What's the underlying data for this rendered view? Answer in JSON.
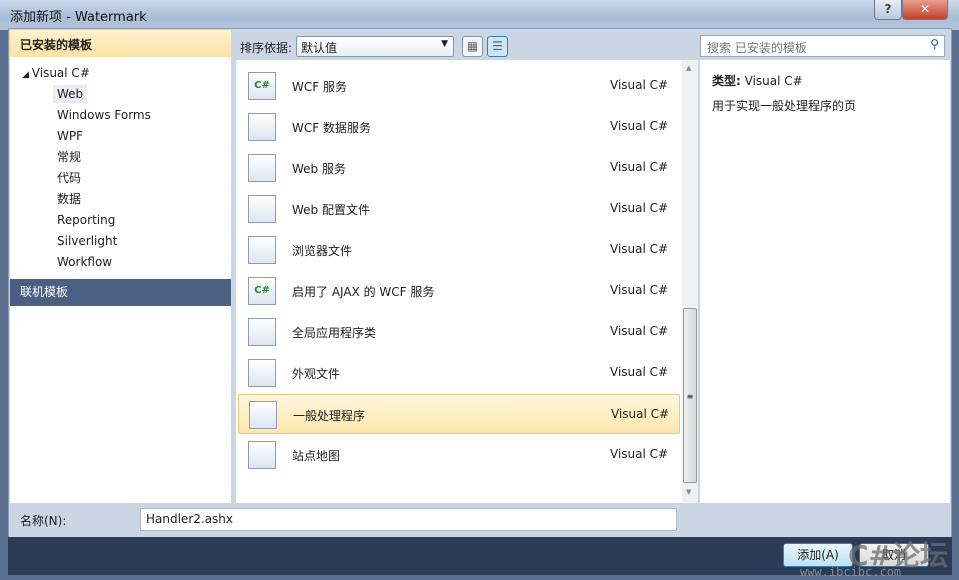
{
  "window": {
    "title": "添加新项 - Watermark",
    "help": "?",
    "close": "✕"
  },
  "left": {
    "header": "已安装的模板",
    "root": "Visual C#",
    "items": [
      "Web",
      "Windows Forms",
      "WPF",
      "常规",
      "代码",
      "数据",
      "Reporting",
      "Silverlight",
      "Workflow"
    ],
    "selected": "Web",
    "online": "联机模板"
  },
  "toolbar": {
    "sort_label": "排序依据:",
    "sort_value": "默认值",
    "search_placeholder": "搜索 已安装的模板"
  },
  "templates": [
    {
      "name": "WCF 服务",
      "lang": "Visual C#",
      "icon": "wcf-service-icon"
    },
    {
      "name": "WCF 数据服务",
      "lang": "Visual C#",
      "icon": "wcf-data-service-icon"
    },
    {
      "name": "Web 服务",
      "lang": "Visual C#",
      "icon": "web-service-icon"
    },
    {
      "name": "Web 配置文件",
      "lang": "Visual C#",
      "icon": "web-config-icon"
    },
    {
      "name": "浏览器文件",
      "lang": "Visual C#",
      "icon": "browser-file-icon"
    },
    {
      "name": "启用了 AJAX 的 WCF 服务",
      "lang": "Visual C#",
      "icon": "ajax-wcf-icon"
    },
    {
      "name": "全局应用程序类",
      "lang": "Visual C#",
      "icon": "global-app-class-icon"
    },
    {
      "name": "外观文件",
      "lang": "Visual C#",
      "icon": "skin-file-icon"
    },
    {
      "name": "一般处理程序",
      "lang": "Visual C#",
      "icon": "generic-handler-icon"
    },
    {
      "name": "站点地图",
      "lang": "Visual C#",
      "icon": "sitemap-icon"
    }
  ],
  "selected_template": "一般处理程序",
  "details": {
    "type_label": "类型:",
    "type_value": "Visual C#",
    "description": "用于实现一般处理程序的页"
  },
  "name_field": {
    "label": "名称(N):",
    "value": "Handler2.ashx"
  },
  "buttons": {
    "add": "添加(A)",
    "cancel": "取消"
  },
  "watermark": {
    "text": "C#论坛",
    "url": "www.ibcibc.com"
  }
}
